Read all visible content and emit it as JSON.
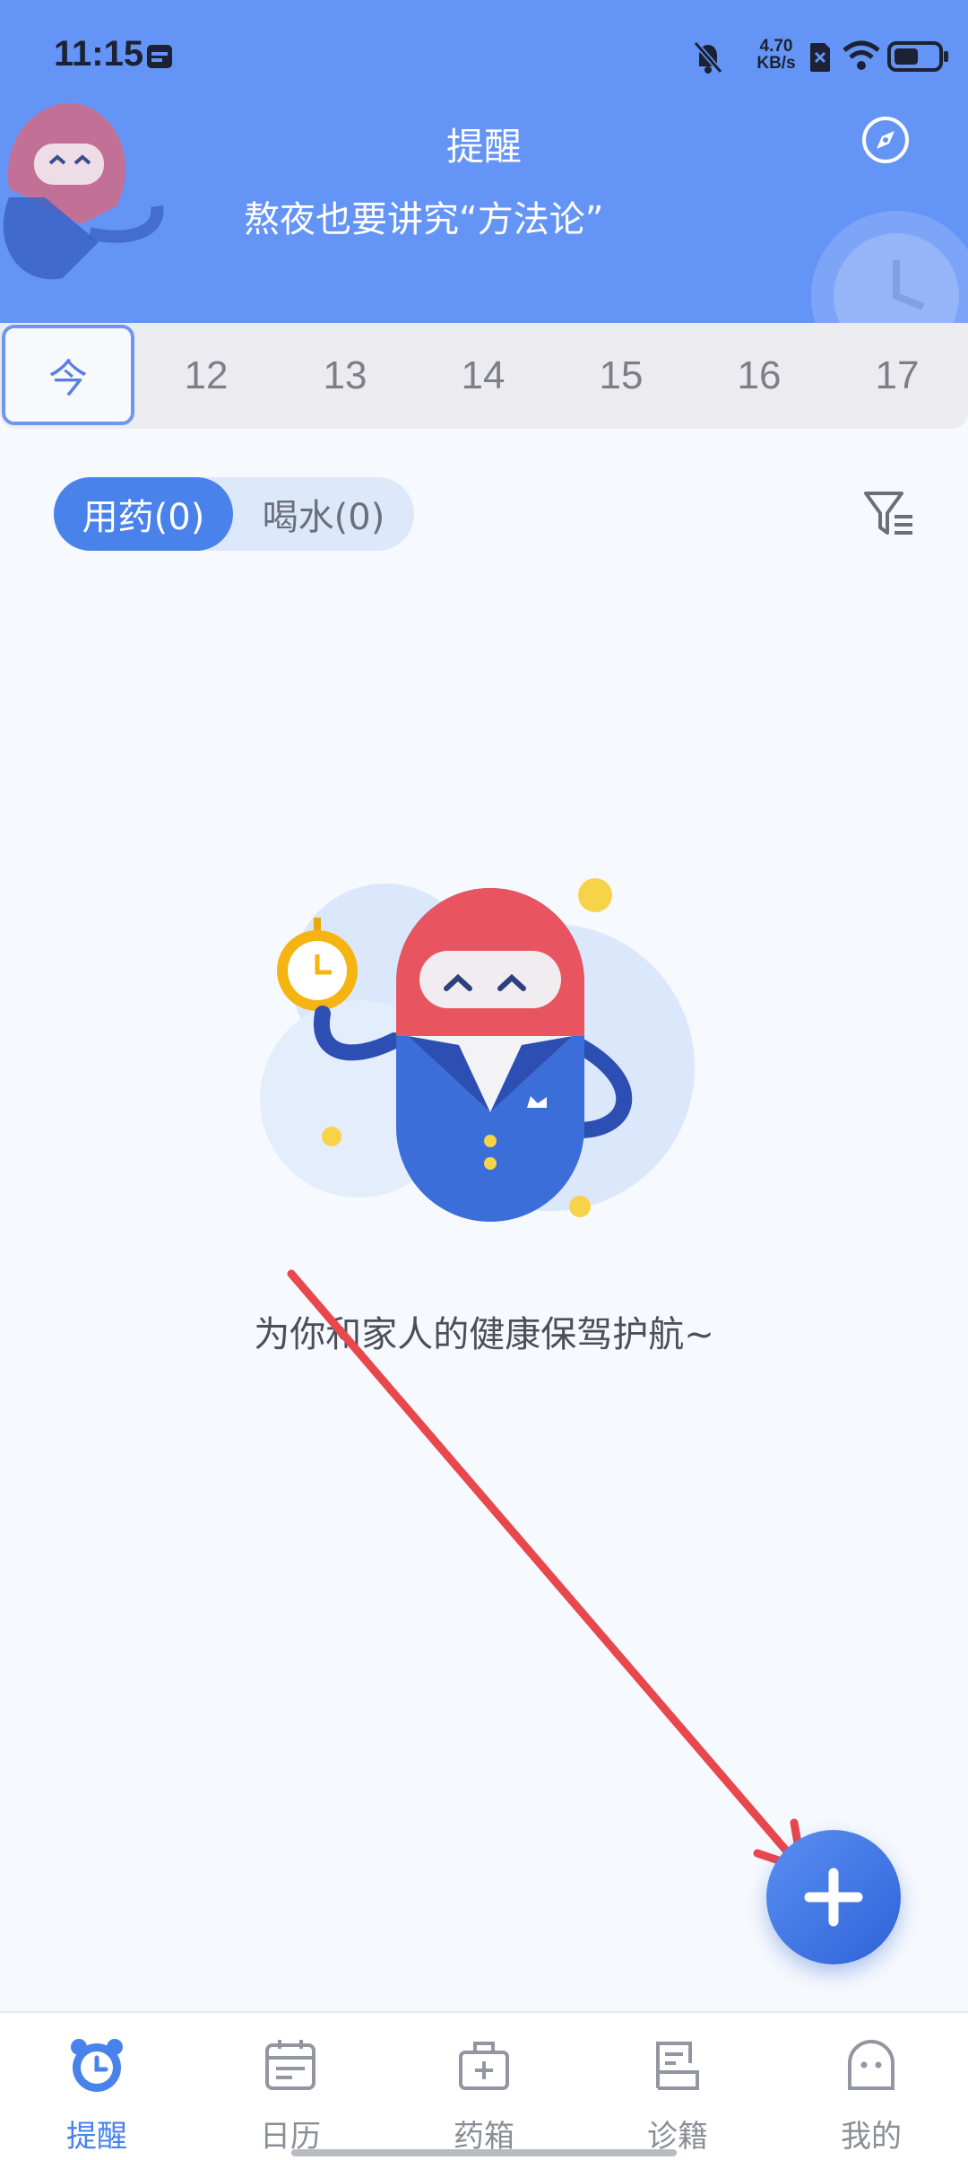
{
  "status_bar": {
    "time": "11:15",
    "net_speed_value": "4.70",
    "net_speed_unit": "KB/s"
  },
  "header": {
    "title": "提醒",
    "subtitle": "熬夜也要讲究“方法论”"
  },
  "date_strip": {
    "items": [
      "今",
      "12",
      "13",
      "14",
      "15",
      "16",
      "17"
    ]
  },
  "tabs": {
    "medication": "用药(0)",
    "water": "喝水(0)"
  },
  "empty_state": {
    "message": "为你和家人的健康保驾护航~"
  },
  "bottom_nav": {
    "items": [
      {
        "label": "提醒",
        "icon": "alarm-clock-icon"
      },
      {
        "label": "日历",
        "icon": "calendar-icon"
      },
      {
        "label": "药箱",
        "icon": "medicine-box-icon"
      },
      {
        "label": "诊籍",
        "icon": "medical-record-icon"
      },
      {
        "label": "我的",
        "icon": "profile-icon"
      }
    ],
    "active_index": 0
  },
  "colors": {
    "header_bg": "#6494f5",
    "accent": "#4a82ec",
    "annotation_arrow": "#e8474d"
  }
}
